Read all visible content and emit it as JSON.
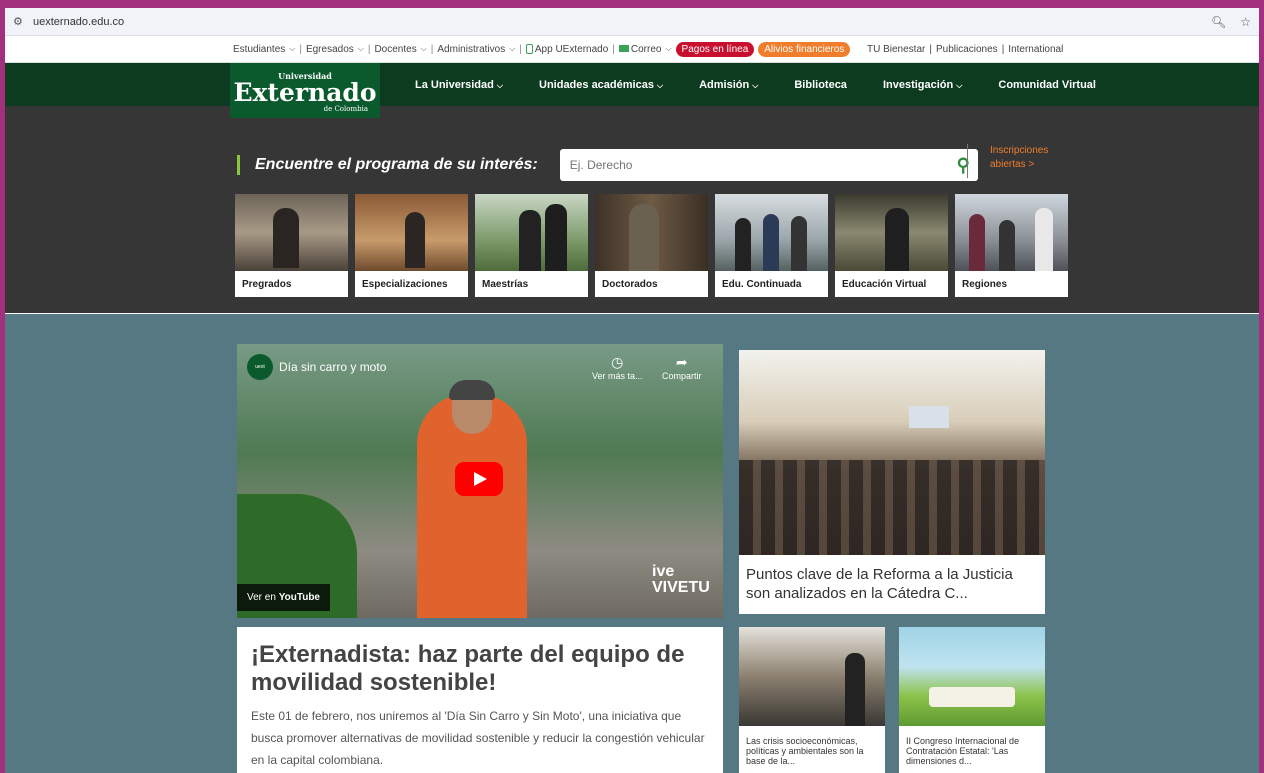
{
  "browser": {
    "url": "uexternado.edu.co"
  },
  "utility_bar": {
    "links": [
      "Estudiantes",
      "Egresados",
      "Docentes",
      "Administrativos"
    ],
    "app": "App UExternado",
    "correo": "Correo",
    "pagos": "Pagos en línea",
    "alivios": "Alivios financieros",
    "right_links": [
      "TU Bienestar",
      "Publicaciones",
      "International"
    ]
  },
  "logo": {
    "line1": "Universidad",
    "line2": "Externado",
    "line3": "de Colombia"
  },
  "nav": [
    "La Universidad",
    "Unidades académicas",
    "Admisión",
    "Biblioteca",
    "Investigación",
    "Comunidad Virtual"
  ],
  "search": {
    "title": "Encuentre el programa de su interés:",
    "placeholder": "Ej. Derecho",
    "insc1": "Inscripciones",
    "insc2": "abiertas >"
  },
  "programs": [
    "Pregrados",
    "Especializaciones",
    "Maestrías",
    "Doctorados",
    "Edu. Continuada",
    "Educación Virtual",
    "Regiones"
  ],
  "video": {
    "title": "Día sin carro y moto",
    "more": "Ver más ta...",
    "share": "Compartir",
    "watch_on": "Ver en",
    "youtube": "YouTube",
    "vive1": "ive",
    "vive2": "VIVETU"
  },
  "headline": {
    "title": "¡Externadista: haz parte del equipo de movilidad sostenible!",
    "body": "Este 01 de febrero, nos uniremos al 'Día Sin Carro y Sin Moto', una iniciativa que busca promover alternativas de movilidad sostenible y reducir la congestión vehicular en la capital colombiana."
  },
  "side_news": {
    "title": "Puntos clave de la Reforma a la Justicia son analizados en la Cátedra C..."
  },
  "small_news": [
    {
      "title": "Las crisis socioeconómicas, políticas y ambientales son la base de la..."
    },
    {
      "title": "II Congreso Internacional de Contratación Estatal: 'Las dimensiones d..."
    }
  ]
}
